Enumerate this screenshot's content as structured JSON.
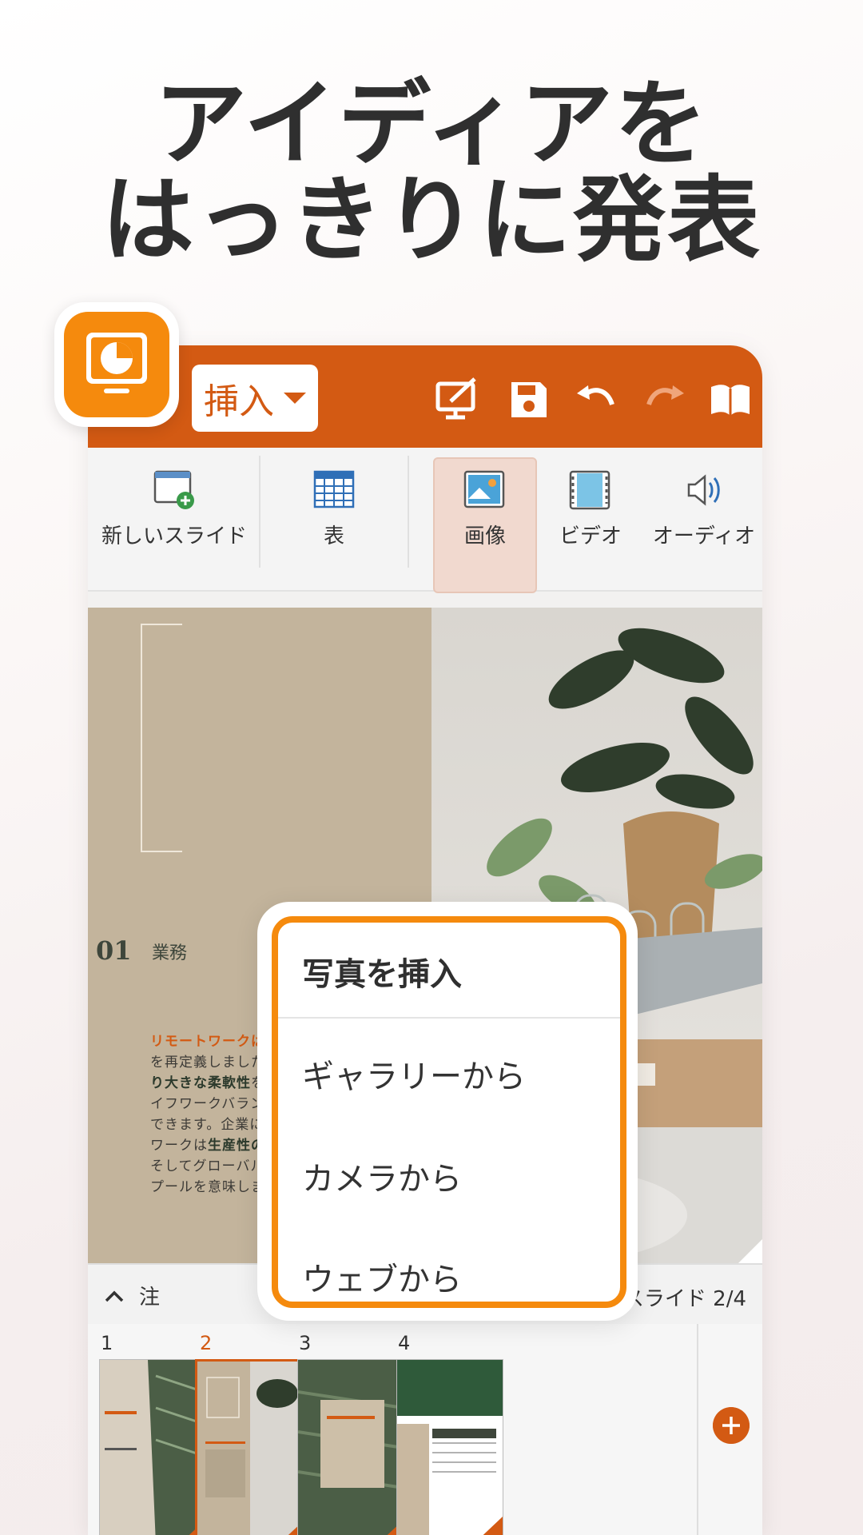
{
  "headline": {
    "line1": "アイディアを",
    "line2": "はっきりに発表"
  },
  "toolbar": {
    "insert_label": "挿入",
    "icons": [
      "present-icon",
      "save-icon",
      "undo-icon",
      "redo-icon",
      "read-mode-icon"
    ]
  },
  "ribbon": {
    "items": [
      {
        "label": "新しいスライド",
        "icon": "new-slide-icon"
      },
      {
        "label": "表",
        "icon": "table-icon"
      },
      {
        "label": "画像",
        "icon": "image-icon",
        "active": true
      },
      {
        "label": "ビデオ",
        "icon": "video-icon"
      },
      {
        "label": "オーディオ",
        "icon": "audio-icon"
      }
    ]
  },
  "popup": {
    "title": "写真を挿入",
    "items": [
      "ギャラリーから",
      "カメラから",
      "ウェブから"
    ]
  },
  "slide": {
    "number": "01",
    "subtitle": "業務",
    "text_highlight": "リモートワークは",
    "text_1": "ビジネスのやり方を再定義しました。 従業員は、",
    "text_bold_1": "より大きな柔軟性",
    "text_2": "を持ち、より良いライフワークバランスを楽しむことができます。企業にとって、リモートワークは",
    "text_bold_2": "生産性の向上",
    "text_3": "、経費削減、そしてグローバルに広がるタレントプールを意味します。"
  },
  "notes": {
    "label": "注",
    "slide_indicator": "スライド 2/4"
  },
  "thumbnails": [
    {
      "num": "1"
    },
    {
      "num": "2",
      "selected": true
    },
    {
      "num": "3"
    },
    {
      "num": "4"
    }
  ],
  "colors": {
    "brand": "#d35a13",
    "accent": "#f58a0d",
    "background": "#fbf7f6"
  }
}
